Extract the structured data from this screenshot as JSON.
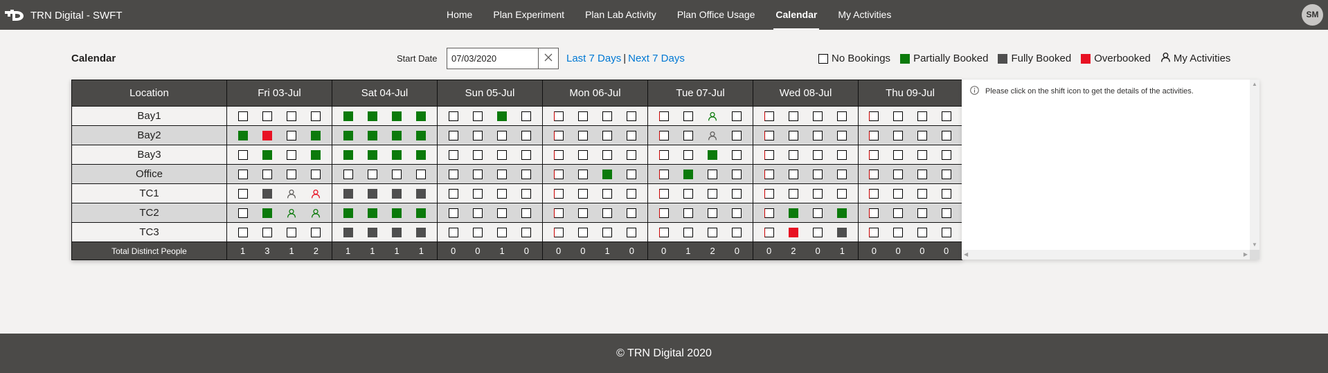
{
  "app": {
    "title": "TRN Digital - SWFT",
    "user_initials": "SM"
  },
  "nav": [
    {
      "label": "Home",
      "active": false
    },
    {
      "label": "Plan Experiment",
      "active": false
    },
    {
      "label": "Plan Lab Activity",
      "active": false
    },
    {
      "label": "Plan Office Usage",
      "active": false
    },
    {
      "label": "Calendar",
      "active": true
    },
    {
      "label": "My Activities",
      "active": false
    }
  ],
  "page": {
    "title": "Calendar",
    "start_date_label": "Start Date",
    "start_date_value": "07/03/2020",
    "last_label": "Last 7 Days",
    "next_label": "Next 7 Days",
    "separator": "|"
  },
  "legend": [
    {
      "label": "No Bookings",
      "kind": "none"
    },
    {
      "label": "Partially Booked",
      "kind": "partial",
      "color": "#0b7a0b"
    },
    {
      "label": "Fully Booked",
      "kind": "full",
      "color": "#4f4f4f"
    },
    {
      "label": "Overbooked",
      "kind": "over",
      "color": "#e81123"
    },
    {
      "label": "My Activities",
      "kind": "person"
    }
  ],
  "grid": {
    "location_header": "Location",
    "days": [
      "Fri 03-Jul",
      "Sat 04-Jul",
      "Sun 05-Jul",
      "Mon 06-Jul",
      "Tue 07-Jul",
      "Wed 08-Jul",
      "Thu 09-Jul"
    ],
    "rows": [
      {
        "location": "Bay1",
        "slots": [
          [
            "n",
            "n",
            "n",
            "n"
          ],
          [
            "p",
            "p",
            "p",
            "p"
          ],
          [
            "n",
            "n",
            "p",
            "n"
          ],
          [
            "nr",
            "n",
            "n",
            "n"
          ],
          [
            "nr",
            "n",
            "mg",
            "n"
          ],
          [
            "nr",
            "n",
            "n",
            "n"
          ],
          [
            "nr",
            "n",
            "n",
            "n"
          ]
        ]
      },
      {
        "location": "Bay2",
        "slots": [
          [
            "p",
            "o",
            "n",
            "p"
          ],
          [
            "p",
            "p",
            "p",
            "p"
          ],
          [
            "n",
            "n",
            "n",
            "n"
          ],
          [
            "nr",
            "n",
            "n",
            "n"
          ],
          [
            "nr",
            "n",
            "mk",
            "n"
          ],
          [
            "nr",
            "n",
            "n",
            "n"
          ],
          [
            "nr",
            "n",
            "n",
            "n"
          ]
        ]
      },
      {
        "location": "Bay3",
        "slots": [
          [
            "n",
            "p",
            "n",
            "p"
          ],
          [
            "p",
            "p",
            "p",
            "p"
          ],
          [
            "n",
            "n",
            "n",
            "n"
          ],
          [
            "nr",
            "n",
            "n",
            "n"
          ],
          [
            "nr",
            "n",
            "p",
            "n"
          ],
          [
            "nr",
            "n",
            "n",
            "n"
          ],
          [
            "nr",
            "n",
            "n",
            "n"
          ]
        ]
      },
      {
        "location": "Office",
        "slots": [
          [
            "n",
            "n",
            "n",
            "n"
          ],
          [
            "n",
            "n",
            "n",
            "n"
          ],
          [
            "n",
            "n",
            "n",
            "n"
          ],
          [
            "nr",
            "n",
            "p",
            "n"
          ],
          [
            "nr",
            "p",
            "n",
            "n"
          ],
          [
            "nr",
            "n",
            "n",
            "n"
          ],
          [
            "nr",
            "n",
            "n",
            "n"
          ]
        ]
      },
      {
        "location": "TC1",
        "slots": [
          [
            "n",
            "f",
            "mk",
            "mr"
          ],
          [
            "f",
            "f",
            "f",
            "f"
          ],
          [
            "n",
            "n",
            "n",
            "n"
          ],
          [
            "nr",
            "n",
            "n",
            "n"
          ],
          [
            "nr",
            "n",
            "n",
            "n"
          ],
          [
            "nr",
            "n",
            "n",
            "n"
          ],
          [
            "nr",
            "n",
            "n",
            "n"
          ]
        ]
      },
      {
        "location": "TC2",
        "slots": [
          [
            "n",
            "p",
            "mg",
            "mg"
          ],
          [
            "p",
            "p",
            "p",
            "p"
          ],
          [
            "n",
            "n",
            "n",
            "n"
          ],
          [
            "nr",
            "n",
            "n",
            "n"
          ],
          [
            "nr",
            "n",
            "n",
            "n"
          ],
          [
            "nr",
            "p",
            "n",
            "p"
          ],
          [
            "nr",
            "n",
            "n",
            "n"
          ]
        ]
      },
      {
        "location": "TC3",
        "slots": [
          [
            "n",
            "n",
            "n",
            "n"
          ],
          [
            "f",
            "f",
            "f",
            "f"
          ],
          [
            "n",
            "n",
            "n",
            "n"
          ],
          [
            "nr",
            "n",
            "n",
            "n"
          ],
          [
            "nr",
            "n",
            "n",
            "n"
          ],
          [
            "nr",
            "o",
            "n",
            "f"
          ],
          [
            "nr",
            "n",
            "n",
            "n"
          ]
        ]
      }
    ],
    "totals_label": "Total Distinct People",
    "totals": [
      [
        1,
        3,
        1,
        2
      ],
      [
        1,
        1,
        1,
        1
      ],
      [
        0,
        0,
        1,
        0
      ],
      [
        0,
        0,
        1,
        0
      ],
      [
        0,
        1,
        2,
        0
      ],
      [
        0,
        2,
        0,
        1
      ],
      [
        0,
        0,
        0,
        0
      ]
    ]
  },
  "side_panel": {
    "message": "Please click on the shift icon to get the details of the activities."
  },
  "footer": {
    "text": "© TRN Digital 2020"
  }
}
